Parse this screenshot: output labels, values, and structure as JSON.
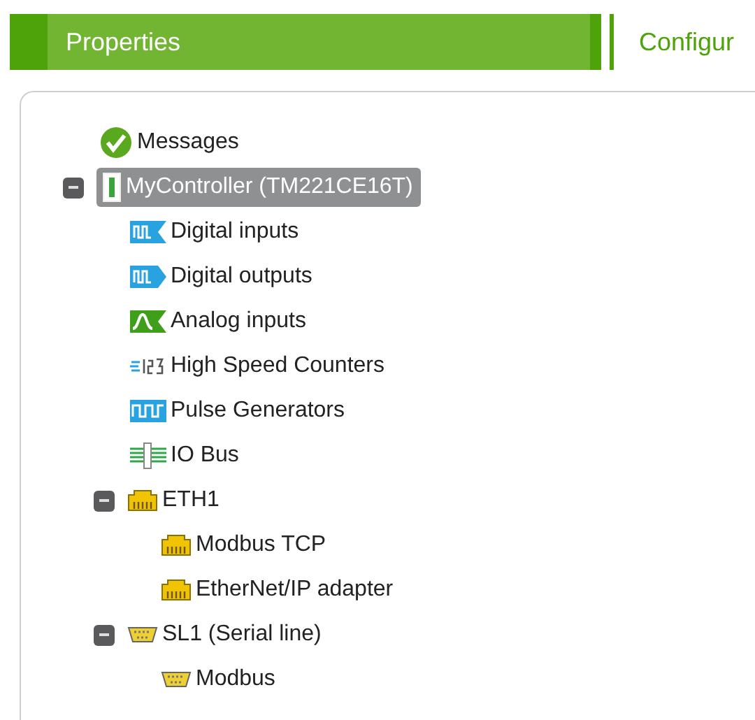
{
  "tabs": [
    {
      "label": "Properties",
      "selected": true
    },
    {
      "label": "Configur",
      "selected": false
    }
  ],
  "tree": [
    {
      "label": "Messages",
      "kind": "check",
      "selected": false
    },
    {
      "label": "MyController (TM221CE16T)",
      "kind": "controller",
      "selected": true,
      "expanded": true,
      "children": [
        {
          "label": "Digital inputs",
          "kind": "digital-in",
          "selected": false
        },
        {
          "label": "Digital outputs",
          "kind": "digital-out",
          "selected": false
        },
        {
          "label": "Analog inputs",
          "kind": "analog",
          "selected": false
        },
        {
          "label": "High Speed Counters",
          "kind": "counter",
          "selected": false
        },
        {
          "label": "Pulse Generators",
          "kind": "pulse",
          "selected": false
        },
        {
          "label": "IO Bus",
          "kind": "iobus",
          "selected": false
        },
        {
          "label": "ETH1",
          "kind": "ethernet",
          "selected": false,
          "expanded": true,
          "children": [
            {
              "label": "Modbus TCP",
              "kind": "ethernet",
              "selected": false
            },
            {
              "label": "EtherNet/IP adapter",
              "kind": "ethernet",
              "selected": false
            }
          ]
        },
        {
          "label": "SL1 (Serial line)",
          "kind": "serial",
          "selected": false,
          "expanded": true,
          "children": [
            {
              "label": "Modbus",
              "kind": "serial",
              "selected": false
            }
          ]
        }
      ]
    }
  ]
}
